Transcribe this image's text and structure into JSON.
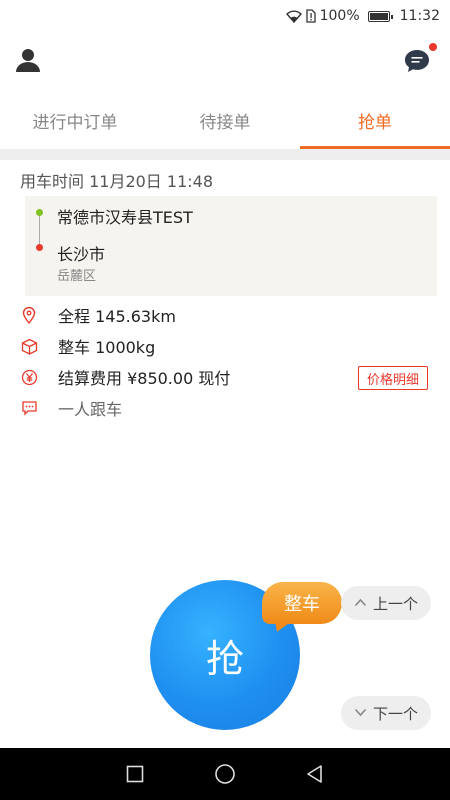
{
  "status_bar": {
    "battery": "100%",
    "time": "11:32",
    "battery_level": 1.0
  },
  "header": {
    "user_icon": "user-icon",
    "message_icon": "chat-bubble-icon",
    "has_notification": true
  },
  "tabs": [
    {
      "label": "进行中订单",
      "active": false
    },
    {
      "label": "待接单",
      "active": false
    },
    {
      "label": "抢单",
      "active": true
    }
  ],
  "order": {
    "use_time": "用车时间 11月20日 11:48",
    "from": "常德市汉寿县TEST",
    "to": "长沙市",
    "to_district": "岳麓区",
    "distance": "全程 145.63km",
    "vehicle": "整车 1000kg",
    "fee": "结算费用 ¥850.00 现付",
    "price_detail_button": "价格明细",
    "remark": "一人跟车"
  },
  "actions": {
    "grab_label": "抢",
    "tag_label": "整车",
    "prev_label": "上一个",
    "next_label": "下一个"
  },
  "colors": {
    "accent": "#f26b24",
    "blue": "#1e8ff0",
    "red": "#e8392b",
    "green": "#7ec320"
  }
}
